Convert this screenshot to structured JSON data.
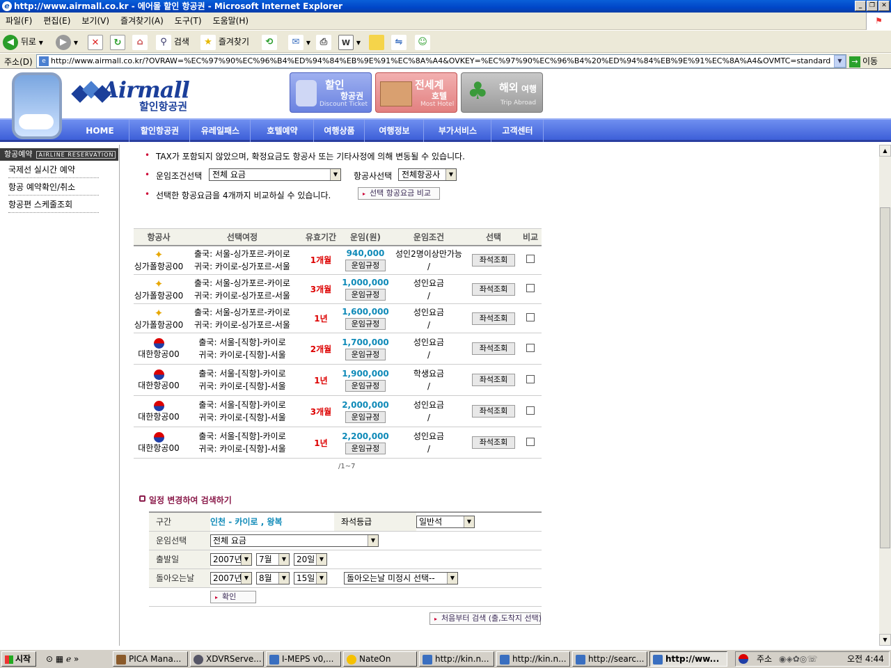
{
  "browser": {
    "title": "http://www.airmall.co.kr - 에어몰 할인 항공권 - Microsoft Internet Explorer",
    "menu": [
      "파일(F)",
      "편집(E)",
      "보기(V)",
      "즐겨찾기(A)",
      "도구(T)",
      "도움말(H)"
    ],
    "back_label": "뒤로",
    "search_label": "검색",
    "favorites_label": "즐겨찾기",
    "address_label": "주소(D)",
    "url": "http://www.airmall.co.kr/?OVRAW=%EC%97%90%EC%96%B4%ED%94%84%EB%9E%91%EC%8A%A4&OVKEY=%EC%97%90%EC%96%B4%20%ED%94%84%EB%9E%91%EC%8A%A4&OVMTC=standard",
    "go_label": "이동"
  },
  "site": {
    "logo_text": "Airmall",
    "logo_sub": "할인항공권",
    "top_buttons": [
      {
        "t1": "할인",
        "t2": "항공권",
        "t3": "Discount Ticket"
      },
      {
        "t1": "전세계",
        "t2": "호텔",
        "t3": "Most Hotel"
      },
      {
        "t1": "해외",
        "t2": "여행",
        "t3": "Trip Abroad"
      }
    ],
    "nav": [
      "HOME",
      "할인항공권",
      "유레일패스",
      "호텔예약",
      "여행상품",
      "여행정보",
      "부가서비스",
      "고객센터"
    ]
  },
  "sidebar": {
    "header": "항공예약",
    "header_eng": "AIRLINE RESERVATION",
    "items": [
      "국제선 실시간 예약",
      "항공 예약확인/취소",
      "항공편 스케줄조회"
    ]
  },
  "notice": {
    "tax_text": "TAX가 포함되지 않았으며, 확정요금도 항공사 또는 기타사정에 의해 변동될 수 있습니다.",
    "fare_cond_label": "운임조건선택",
    "fare_cond_value": "전체 요금",
    "airline_label": "항공사선택",
    "airline_value": "전체항공사",
    "compare_text": "선택한 항공요금을 4개까지 비교하실 수 있습니다.",
    "compare_btn": "선택 항공요금 비교"
  },
  "table": {
    "headers": [
      "항공사",
      "선택여정",
      "유효기간",
      "운임(원)",
      "운임조건",
      "선택",
      "비교"
    ],
    "rule_btn": "운임규정",
    "seat_btn": "좌석조회",
    "rows": [
      {
        "airline": "싱가폴항공00",
        "out": "출국: 서울-싱가포르-카이로",
        "ret": "귀국: 카이로-싱가포르-서울",
        "period": "1개월",
        "fare": "940,000",
        "cond1": "성인2명이상만가능",
        "cond2": "/"
      },
      {
        "airline": "싱가폴항공00",
        "out": "출국: 서울-싱가포르-카이로",
        "ret": "귀국: 카이로-싱가포르-서울",
        "period": "3개월",
        "fare": "1,000,000",
        "cond1": "성인요금",
        "cond2": "/"
      },
      {
        "airline": "싱가폴항공00",
        "out": "출국: 서울-싱가포르-카이로",
        "ret": "귀국: 카이로-싱가포르-서울",
        "period": "1년",
        "fare": "1,600,000",
        "cond1": "성인요금",
        "cond2": "/"
      },
      {
        "airline": "대한항공00",
        "out": "출국: 서울-[직항]-카이로",
        "ret": "귀국: 카이로-[직항]-서울",
        "period": "2개월",
        "fare": "1,700,000",
        "cond1": "성인요금",
        "cond2": "/"
      },
      {
        "airline": "대한항공00",
        "out": "출국: 서울-[직항]-카이로",
        "ret": "귀국: 카이로-[직항]-서울",
        "period": "1년",
        "fare": "1,900,000",
        "cond1": "학생요금",
        "cond2": "/"
      },
      {
        "airline": "대한항공00",
        "out": "출국: 서울-[직항]-카이로",
        "ret": "귀국: 카이로-[직항]-서울",
        "period": "3개월",
        "fare": "2,000,000",
        "cond1": "성인요금",
        "cond2": "/"
      },
      {
        "airline": "대한항공00",
        "out": "출국: 서울-[직항]-카이로",
        "ret": "귀국: 카이로-[직항]-서울",
        "period": "1년",
        "fare": "2,200,000",
        "cond1": "성인요금",
        "cond2": "/"
      }
    ],
    "pagination": "/1~7"
  },
  "search": {
    "title": "일정 변경하여 검색하기",
    "route_label": "구간",
    "route_value": "인천 - 카이로 , 왕복",
    "class_label": "좌석등급",
    "class_value": "일반석",
    "fare_label": "운임선택",
    "fare_value": "전체 요금",
    "depart_label": "출발일",
    "depart_year": "2007년",
    "depart_month": "7월",
    "depart_day": "20일",
    "return_label": "돌아오는날",
    "return_year": "2007년",
    "return_month": "8월",
    "return_day": "15일",
    "return_undecided": "돌아오는날 미정시 선택--",
    "confirm_btn": "확인",
    "restart_btn": "처음부터 검색 (출,도착지 선택)"
  },
  "taskbar": {
    "start": "시작",
    "tasks": [
      "PICA Mana...",
      "XDVRServe...",
      "I-MEPS v0,...",
      "NateOn",
      "http://kin.n...",
      "http://kin.n...",
      "http://searc...",
      "http://ww..."
    ],
    "tray_addr": "주소",
    "clock": "오전 4:44"
  },
  "colors": {
    "fare": "#0f8ab8",
    "period": "#dd0000",
    "nav": "#3d5fd8"
  }
}
